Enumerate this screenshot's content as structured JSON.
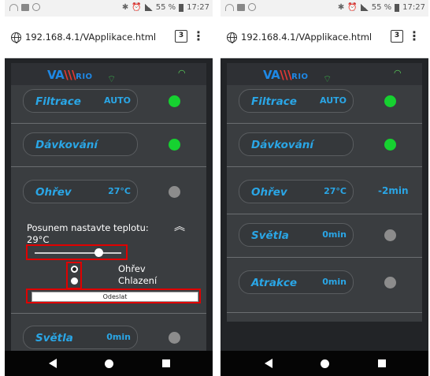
{
  "left": {
    "status": {
      "bluetooth": "✱",
      "alarm": "⏰",
      "battery": "55 %",
      "time": "17:27"
    },
    "browser": {
      "url": "192.168.4.1/VApplikace.html",
      "tabs": "3"
    },
    "app": {
      "logo_prefix": "VA",
      "logo_mid": "\\\\\\",
      "logo_suffix": "RIO",
      "rows": [
        {
          "label": "Filtrace",
          "value": "AUTO",
          "status": "green"
        },
        {
          "label": "Dávkování",
          "value": "",
          "status": "green"
        },
        {
          "label": "Ohřev",
          "value": "27°C",
          "status": "gray"
        }
      ],
      "detail": {
        "instruction": "Posunem nastavte teplotu:",
        "temperature": "29°C",
        "options": [
          "Ohřev",
          "Chlazení"
        ],
        "selected_option": "Chlazení",
        "send_label": "Odeslat"
      },
      "bottom_row": {
        "label": "Světla",
        "value": "0min",
        "status": "gray"
      }
    }
  },
  "right": {
    "status": {
      "bluetooth": "✱",
      "alarm": "⏰",
      "battery": "55 %",
      "time": "17:27"
    },
    "browser": {
      "url": "192.168.4.1/VApplikace.html",
      "tabs": "3"
    },
    "app": {
      "logo_prefix": "VA",
      "logo_mid": "\\\\\\",
      "logo_suffix": "RIO",
      "rows": [
        {
          "label": "Filtrace",
          "value": "AUTO",
          "status": "green"
        },
        {
          "label": "Dávkování",
          "value": "",
          "status": "green"
        },
        {
          "label": "Ohřev",
          "value": "27°C",
          "status": "text",
          "extra": "-2min"
        },
        {
          "label": "Světla",
          "value": "0min",
          "status": "gray"
        },
        {
          "label": "Atrakce",
          "value": "0min",
          "status": "gray"
        }
      ]
    }
  },
  "colors": {
    "accent": "#2aa6e6",
    "green": "#16d130",
    "gray": "#8c8c8c",
    "highlight": "#e00000",
    "background": "#222427"
  }
}
